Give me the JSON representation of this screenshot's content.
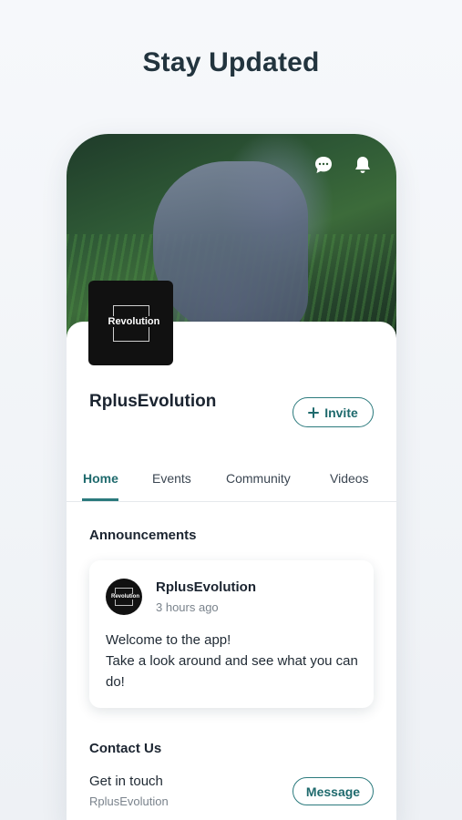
{
  "headline": "Stay Updated",
  "icons": {
    "chat": "chat-bubble-icon",
    "bell": "bell-icon",
    "plus": "plus-icon"
  },
  "profile": {
    "logo_text": "Revolution",
    "name": "RplusEvolution",
    "invite_label": "Invite"
  },
  "tabs": [
    {
      "label": "Home",
      "active": true
    },
    {
      "label": "Events",
      "active": false
    },
    {
      "label": "Community",
      "active": false
    },
    {
      "label": "Videos",
      "active": false
    }
  ],
  "announcements": {
    "title": "Announcements",
    "post": {
      "author": "RplusEvolution",
      "time": "3 hours ago",
      "avatar_text": "Revolution",
      "body_line1": "Welcome to the app!",
      "body_line2": "Take a look around and see what you can do!"
    }
  },
  "contact": {
    "title": "Contact Us",
    "subtitle": "Get in touch",
    "name": "RplusEvolution",
    "message_label": "Message"
  },
  "colors": {
    "accent": "#2b7a7d",
    "text": "#1b2430",
    "muted": "#7a838c"
  }
}
